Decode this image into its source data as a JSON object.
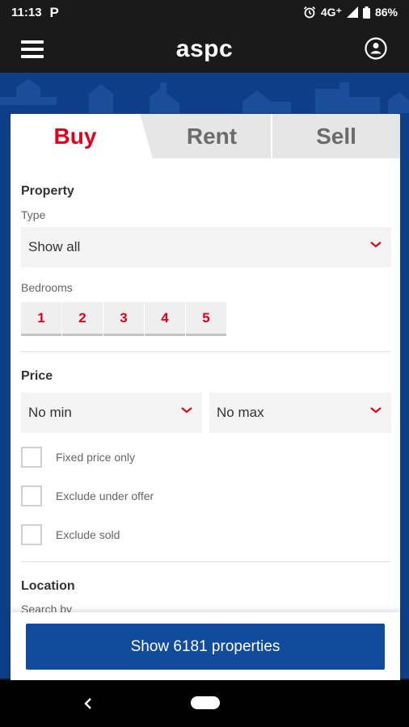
{
  "status": {
    "time": "11:13",
    "network": "4G⁺",
    "battery": "86%"
  },
  "app": {
    "title": "aspc"
  },
  "tabs": [
    {
      "label": "Buy",
      "active": true
    },
    {
      "label": "Rent",
      "active": false
    },
    {
      "label": "Sell",
      "active": false
    }
  ],
  "property": {
    "title": "Property",
    "type_label": "Type",
    "type_value": "Show all",
    "bedrooms_label": "Bedrooms",
    "bedrooms": [
      "1",
      "2",
      "3",
      "4",
      "5"
    ]
  },
  "price": {
    "title": "Price",
    "min": "No min",
    "max": "No max",
    "options": [
      "Fixed price only",
      "Exclude under offer",
      "Exclude sold"
    ]
  },
  "location": {
    "title": "Location",
    "search_by_label": "Search by"
  },
  "action": {
    "label": "Show 6181 properties"
  },
  "colors": {
    "accent": "#e1001a",
    "brand": "#104c9b",
    "hero": "#0e3e87"
  }
}
